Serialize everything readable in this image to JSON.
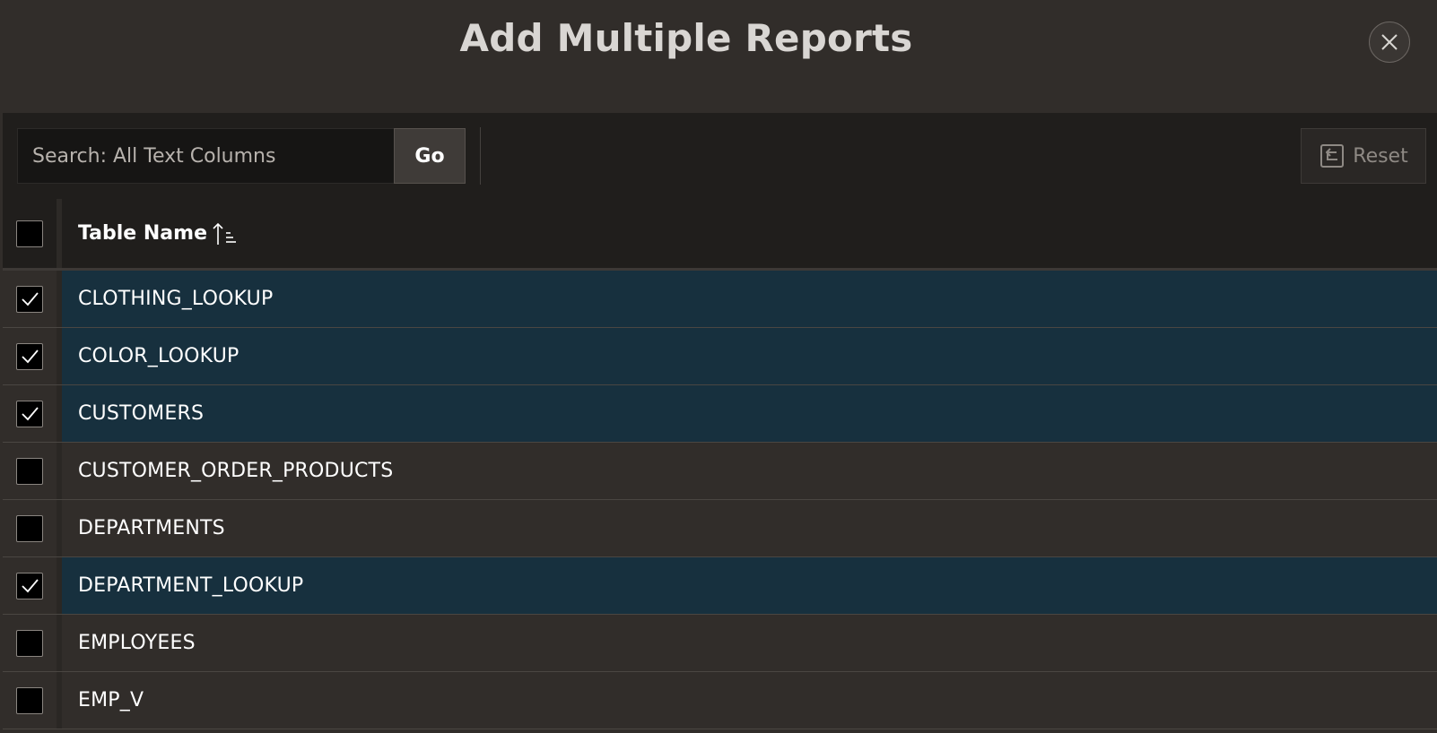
{
  "dialog": {
    "title": "Add Multiple Reports",
    "close_icon": "close-icon"
  },
  "toolbar": {
    "search_placeholder": "Search: All Text Columns",
    "search_value": "",
    "go_label": "Go",
    "reset_label": "Reset",
    "reset_icon": "reset-arrow-icon"
  },
  "table": {
    "column_header": "Table Name",
    "sort_icon": "sort-ascending-icon",
    "select_all_checked": false,
    "rows": [
      {
        "name": "CLOTHING_LOOKUP",
        "checked": true
      },
      {
        "name": "COLOR_LOOKUP",
        "checked": true
      },
      {
        "name": "CUSTOMERS",
        "checked": true
      },
      {
        "name": "CUSTOMER_ORDER_PRODUCTS",
        "checked": false
      },
      {
        "name": "DEPARTMENTS",
        "checked": false
      },
      {
        "name": "DEPARTMENT_LOOKUP",
        "checked": true
      },
      {
        "name": "EMPLOYEES",
        "checked": false
      },
      {
        "name": "EMP_V",
        "checked": false
      }
    ]
  },
  "colors": {
    "background": "#312d2a",
    "toolbar": "#201e1c",
    "selected_row": "#17303e",
    "title_text": "#d9d6d3"
  }
}
